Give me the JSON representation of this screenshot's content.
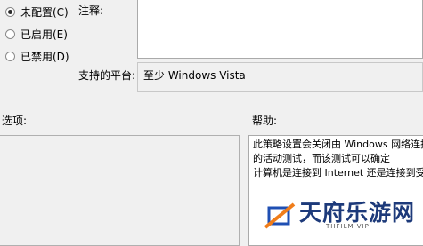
{
  "state_options": [
    {
      "label": "未配置(C)",
      "checked": true
    },
    {
      "label": "已启用(E)",
      "checked": false
    },
    {
      "label": "已禁用(D)",
      "checked": false
    }
  ],
  "comment_label": "注释:",
  "supported_label": "支持的平台:",
  "supported_value": "至少 Windows Vista",
  "options_label": "选项:",
  "help_label": "帮助:",
  "help_lines": [
    "此策略设置会关闭由 Windows 网络连接",
    "的活动测试，而该测试可以确定",
    "计算机是连接到 Internet 还是连接到受"
  ],
  "watermark": {
    "title": "天府乐游网",
    "subtitle": "THFILM VIP"
  }
}
